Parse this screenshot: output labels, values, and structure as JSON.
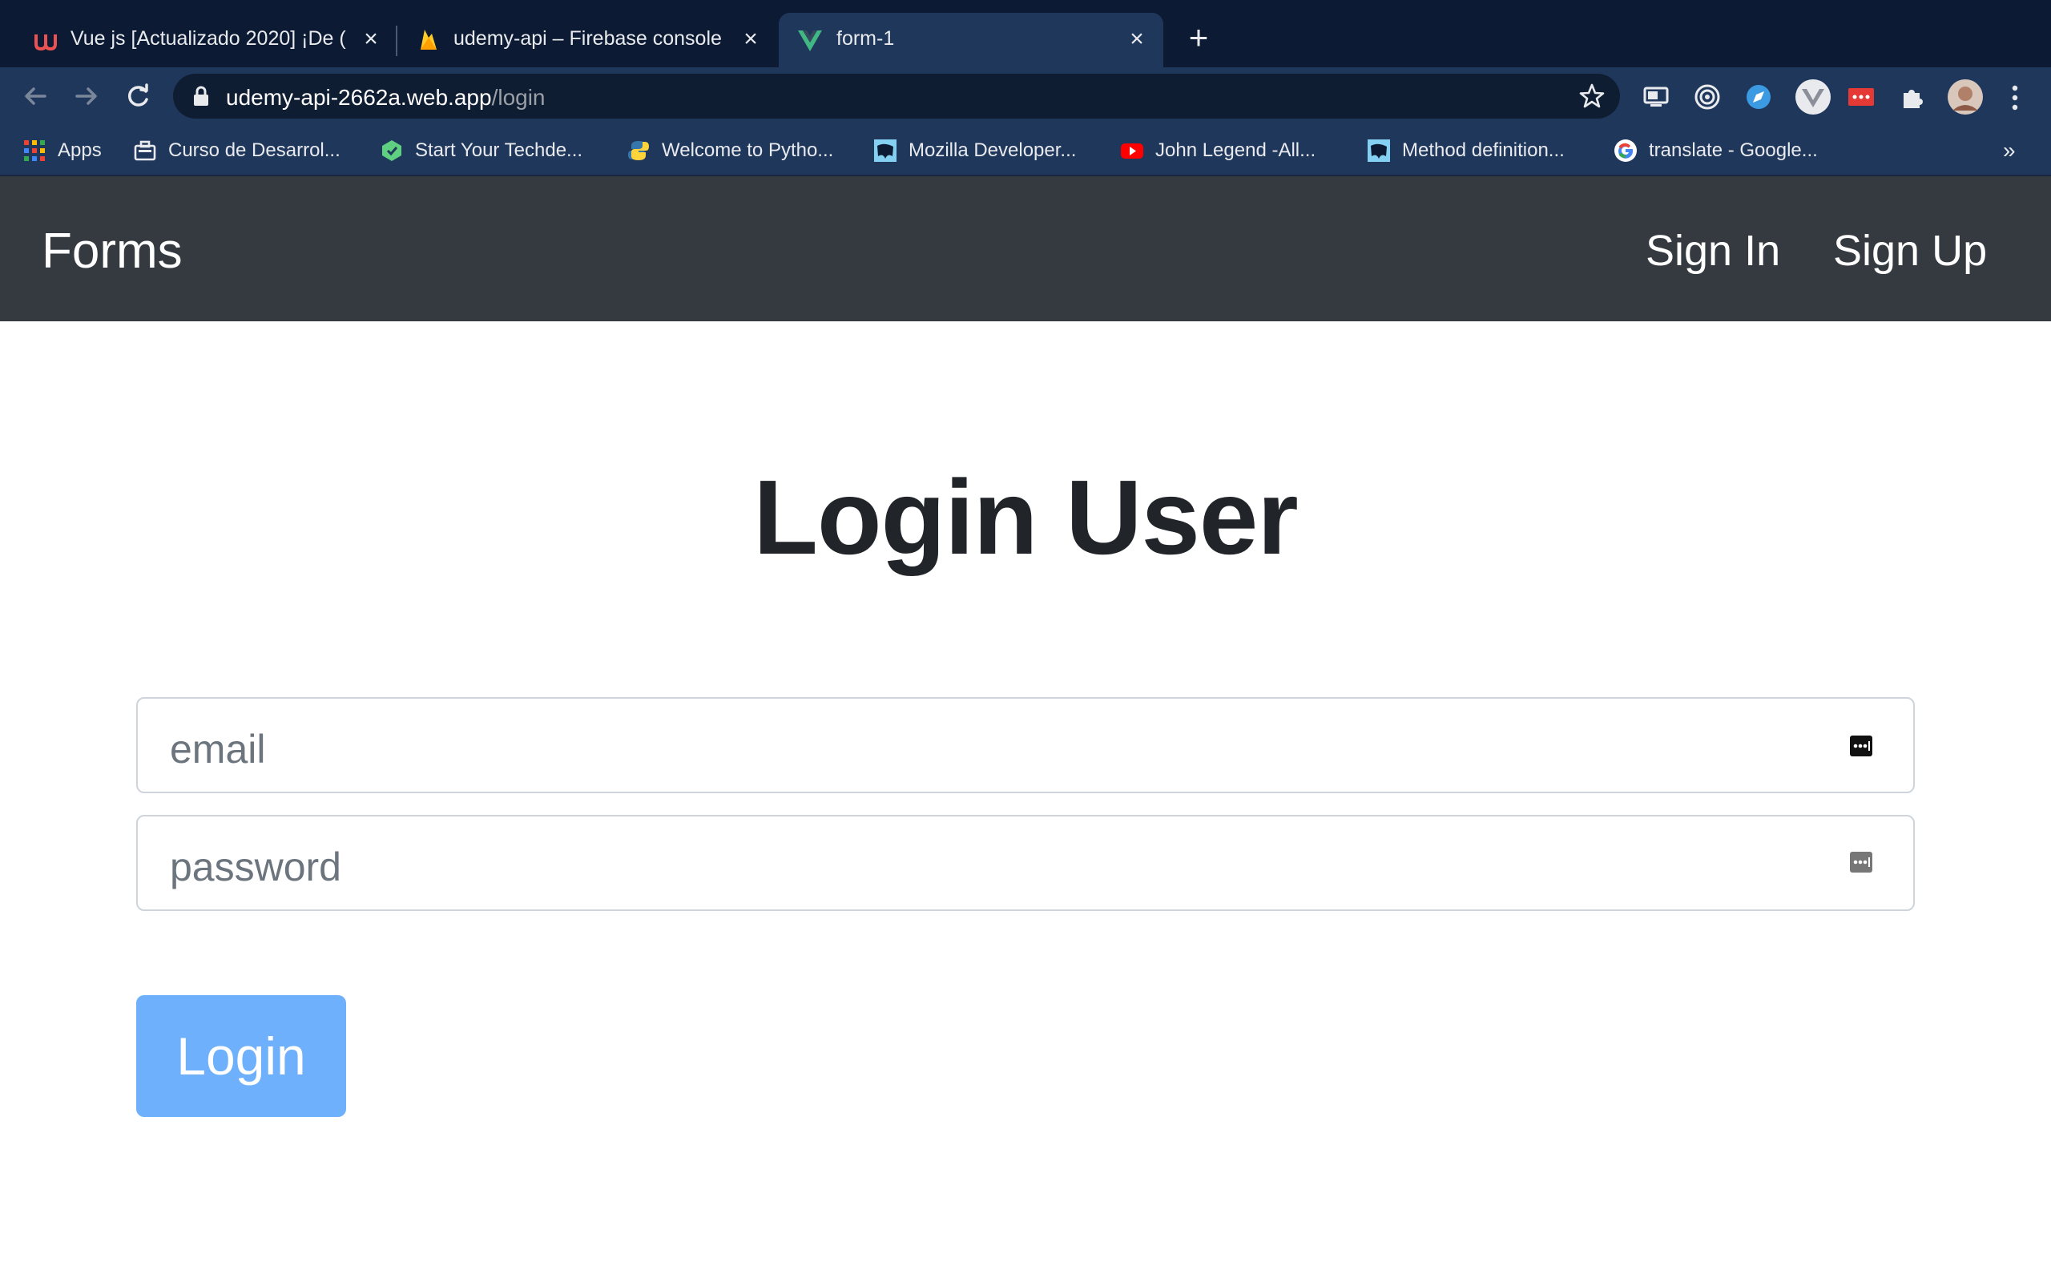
{
  "browser": {
    "tabs": [
      {
        "title": "Vue js [Actualizado 2020] ¡De (",
        "icon": "udemy-icon",
        "active": false
      },
      {
        "title": "udemy-api – Firebase console",
        "icon": "firebase-icon",
        "active": false
      },
      {
        "title": "form-1",
        "icon": "vue-icon",
        "active": true
      }
    ],
    "address": {
      "host": "udemy-api-2662a.web.app",
      "path": "/login"
    },
    "bookmarks": [
      {
        "label": "Apps",
        "icon": "apps-grid-icon"
      },
      {
        "label": "Curso de Desarrol...",
        "icon": "briefcase-icon"
      },
      {
        "label": "Start Your Techde...",
        "icon": "techdegree-icon"
      },
      {
        "label": "Welcome to Pytho...",
        "icon": "python-icon"
      },
      {
        "label": "Mozilla Developer...",
        "icon": "mdn-icon"
      },
      {
        "label": "John Legend -All...",
        "icon": "youtube-icon"
      },
      {
        "label": "Method definition...",
        "icon": "mdn-icon"
      },
      {
        "label": "translate - Google...",
        "icon": "google-icon"
      }
    ],
    "bookmarks_more": "»"
  },
  "navbar": {
    "brand": "Forms",
    "links": [
      "Sign In",
      "Sign Up"
    ]
  },
  "login": {
    "title": "Login User",
    "email_placeholder": "email",
    "password_placeholder": "password",
    "submit_label": "Login"
  },
  "colors": {
    "navbar_bg": "#343a40",
    "button_bg": "#6eb0fb",
    "chrome_dark": "#0c1b33",
    "chrome_toolbar": "#20375c"
  }
}
